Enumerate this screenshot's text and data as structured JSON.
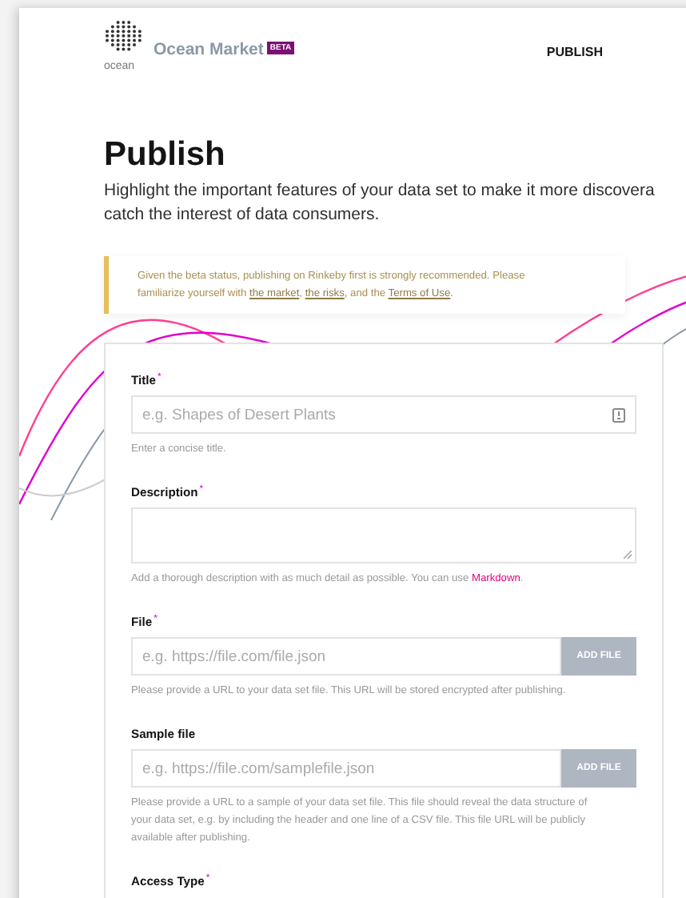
{
  "header": {
    "logo_caption": "ocean",
    "site_name": "Ocean Market",
    "badge": "BETA",
    "nav": [
      {
        "label": "PUBLISH",
        "selected": true
      }
    ]
  },
  "page": {
    "title": "Publish",
    "intro_lines": [
      "Highlight the important features of your data set to make it more discovera",
      "catch the interest of data consumers."
    ]
  },
  "alert": {
    "segments": [
      {
        "text": "Given the beta status, publishing on Rinkeby first is strongly recommended. Please familiarize yourself with ",
        "kind": "text"
      },
      {
        "text": "the market",
        "kind": "link"
      },
      {
        "text": ", ",
        "kind": "text"
      },
      {
        "text": "the risks",
        "kind": "link"
      },
      {
        "text": ", and the ",
        "kind": "text"
      },
      {
        "text": "Terms of Use",
        "kind": "link"
      },
      {
        "text": ".",
        "kind": "text"
      }
    ]
  },
  "form": {
    "fields": [
      {
        "kind": "text",
        "label": "Title",
        "required_mark": "*",
        "placeholder": "e.g. Shapes of Desert Plants",
        "hint": [
          {
            "text": "Enter a concise title.",
            "kind": "text"
          }
        ]
      },
      {
        "kind": "textarea",
        "label": "Description",
        "required_mark": "*",
        "hint": [
          {
            "text": "Add a thorough description with as much detail as possible. You can use ",
            "kind": "text"
          },
          {
            "text": "Markdown",
            "kind": "link"
          },
          {
            "text": ".",
            "kind": "text"
          }
        ]
      },
      {
        "kind": "file",
        "label": "File",
        "required_mark": "*",
        "placeholder": "e.g. https://file.com/file.json",
        "button": "ADD FILE",
        "hint": [
          {
            "text": "Please provide a URL to your data set file. This URL will be stored encrypted after publishing.",
            "kind": "text"
          }
        ]
      },
      {
        "kind": "file",
        "label": "Sample file",
        "placeholder": "e.g. https://file.com/samplefile.json",
        "button": "ADD FILE",
        "hint": [
          {
            "text": "Please provide a URL to a sample of your data set file. This file should reveal the data structure of your data set, e.g. by including the header and one line of a CSV file. This file URL will be publicly available after publishing.",
            "kind": "text"
          }
        ]
      },
      {
        "kind": "cut",
        "label": "Access Type",
        "required_mark": "*"
      }
    ]
  }
}
